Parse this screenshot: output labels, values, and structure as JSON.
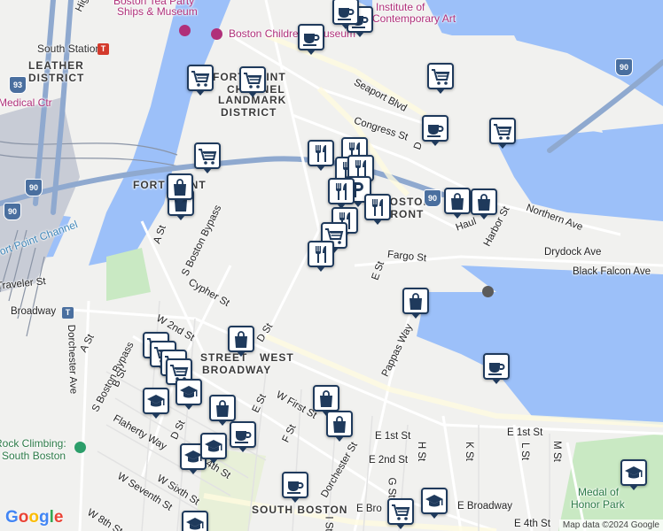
{
  "map": {
    "attribution": "Map data ©2024 Google",
    "logo_letters": [
      "G",
      "o",
      "o",
      "g",
      "l",
      "e"
    ],
    "logo_colors": [
      "#4285f4",
      "#ea4335",
      "#fbbc05",
      "#4285f4",
      "#34a853",
      "#ea4335"
    ],
    "colors": {
      "water": "#9cc0f9",
      "land": "#f1f1ef",
      "park": "#c9e9c3",
      "marker_border": "#1f3a5c",
      "poi": "#b0307a",
      "rail": "#8a94a6"
    }
  },
  "labels": {
    "boston_tea_party": "Boston Tea Party",
    "ships_museum": "Ships & Museum",
    "boston_childrens_museum": "Boston Chil­dren's Museum",
    "institute": "Institute of",
    "contemporary_art": "Contemporary Art",
    "south_station": "South Station",
    "leather_district_1": "LEATHER",
    "leather_district_2": "DISTRICT",
    "fort_point_landmark_1": "FORT POINT",
    "fort_point_landmark_2": "CHANNEL",
    "fort_point_landmark_3": "LANDMARK",
    "fort_point_landmark_4": "DISTRICT",
    "fort_point": "FORT POINT",
    "boston_front": "BOSTON",
    "front_2": "FRONT",
    "medical_ctr": "Medical Ctr",
    "seaport_blvd": "Seaport Blvd",
    "congress_st": "Congress St",
    "northern_ave": "Northern Ave",
    "haul_rd": "Haul",
    "harbor_st": "Harbor St",
    "drydock_ave": "Drydock Ave",
    "black_falcon_ave": "Black Falcon Ave",
    "fargo_st": "Fargo St",
    "e_st": "E St",
    "d_st": "D",
    "a_st": "A St",
    "s_boston_bypass": "S Boston Bypass",
    "s_boston_bypass_2": "S Boston Bypass",
    "cypher_st": "Cypher St",
    "fort_point_channel_water": "Fort Point Channel",
    "traveler_st": "Traveler St",
    "broadway": "Broadway",
    "dorchester_ave": "Dorchester Ave",
    "a_st_2": "A St",
    "b_st": "B St",
    "w_2nd_st": "W 2nd St",
    "d_st_2": "D St",
    "west_broadway_1": "WEST",
    "west_broadway_2": "BROADWAY",
    "w_first_st": "W First St",
    "pappas_way": "Pappas Way",
    "e_1st_st": "E 1st St",
    "e_1st_st_2": "E 1st St",
    "e_2nd_st": "E 2nd St",
    "f_st": "F St",
    "e_st_2": "E St",
    "dorchester_st": "Dorchester St",
    "flaherty_way": "Flaherty Way",
    "d_st_3": "D St",
    "w_seventh_st": "W Seventh St",
    "w_sixth_st": "W Sixth St",
    "w_8th_st": "W 8th St",
    "w_4th_st": "W 4th St",
    "e_4th_st": "E 4th St",
    "south_boston": "SOUTH BOSTON",
    "e_broadway": "E Broadway",
    "e_broadway_2": "E Bro",
    "medal_1": "Medal of",
    "medal_2": "Honor Park",
    "k_st": "K St",
    "l_st": "L St",
    "m_st": "M St",
    "g_st": "G St",
    "h_st": "H St",
    "i_st": "I St",
    "rock_climbing_1": "Rock Climbing:",
    "rock_climbing_2": "South Boston",
    "high_st": "High",
    "street": "STREET",
    "highway_93": "93",
    "highway_90": "90",
    "highway_90b": "90",
    "highway_90c": "90",
    "highway_90d": "90"
  },
  "markers": [
    {
      "type": "coffee"
    },
    {
      "type": "coffee"
    },
    {
      "type": "coffee"
    },
    {
      "type": "grocery"
    },
    {
      "type": "grocery"
    },
    {
      "type": "grocery"
    },
    {
      "type": "grocery"
    },
    {
      "type": "grocery"
    },
    {
      "type": "coffee"
    },
    {
      "type": "restaurant"
    },
    {
      "type": "restaurant"
    },
    {
      "type": "restaurant"
    },
    {
      "type": "restaurant"
    },
    {
      "type": "parking"
    },
    {
      "type": "restaurant"
    },
    {
      "type": "restaurant"
    },
    {
      "type": "restaurant"
    },
    {
      "type": "grocery"
    },
    {
      "type": "restaurant"
    },
    {
      "type": "shopping"
    },
    {
      "type": "shopping"
    },
    {
      "type": "shopping"
    },
    {
      "type": "shopping"
    },
    {
      "type": "shopping"
    },
    {
      "type": "shopping"
    },
    {
      "type": "coffee"
    },
    {
      "type": "grocery"
    },
    {
      "type": "grocery"
    },
    {
      "type": "grocery"
    },
    {
      "type": "grocery"
    },
    {
      "type": "school"
    },
    {
      "type": "school"
    },
    {
      "type": "shopping"
    },
    {
      "type": "coffee"
    },
    {
      "type": "shopping"
    },
    {
      "type": "shopping"
    },
    {
      "type": "school"
    },
    {
      "type": "school"
    },
    {
      "type": "coffee"
    },
    {
      "type": "school"
    },
    {
      "type": "school"
    },
    {
      "type": "grocery"
    },
    {
      "type": "school"
    }
  ]
}
